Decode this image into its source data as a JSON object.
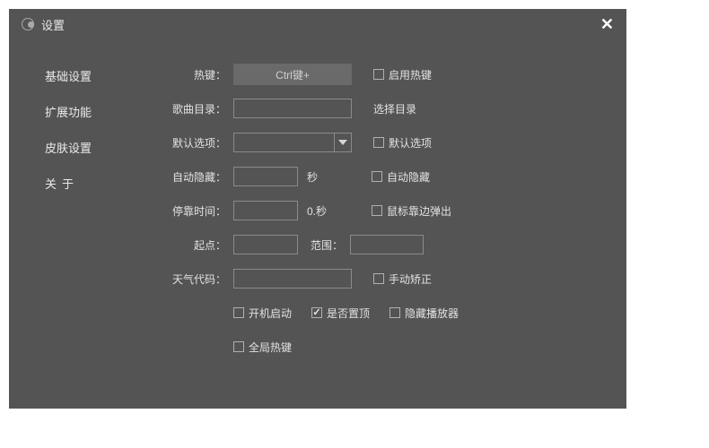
{
  "window": {
    "title": "设置"
  },
  "sidebar": {
    "tabs": [
      {
        "label": "基础设置"
      },
      {
        "label": "扩展功能"
      },
      {
        "label": "皮肤设置"
      },
      {
        "label": "关于"
      }
    ]
  },
  "form": {
    "hotkey": {
      "label": "热键：",
      "button": "Ctrl键+",
      "enable_label": "启用热键"
    },
    "songdir": {
      "label": "歌曲目录：",
      "choose_label": "选择目录",
      "value": ""
    },
    "default": {
      "label": "默认选项：",
      "cb_label": "默认选项",
      "value": ""
    },
    "autohide": {
      "label": "自动隐藏：",
      "unit": "秒",
      "cb_label": "自动隐藏",
      "value": ""
    },
    "dwell": {
      "label": "停靠时间：",
      "unit": "0.秒",
      "cb_label": "鼠标靠边弹出",
      "value": ""
    },
    "start": {
      "label": "起点：",
      "value": ""
    },
    "range": {
      "label": "范围：",
      "value": ""
    },
    "weather": {
      "label": "天气代码：",
      "cb_label": "手动矫正",
      "value": ""
    },
    "cbrow1": {
      "boot": "开机启动",
      "ontop": "是否置顶",
      "hide_player": "隐藏播放器"
    },
    "cbrow2": {
      "global_hotkey": "全局热键"
    }
  }
}
